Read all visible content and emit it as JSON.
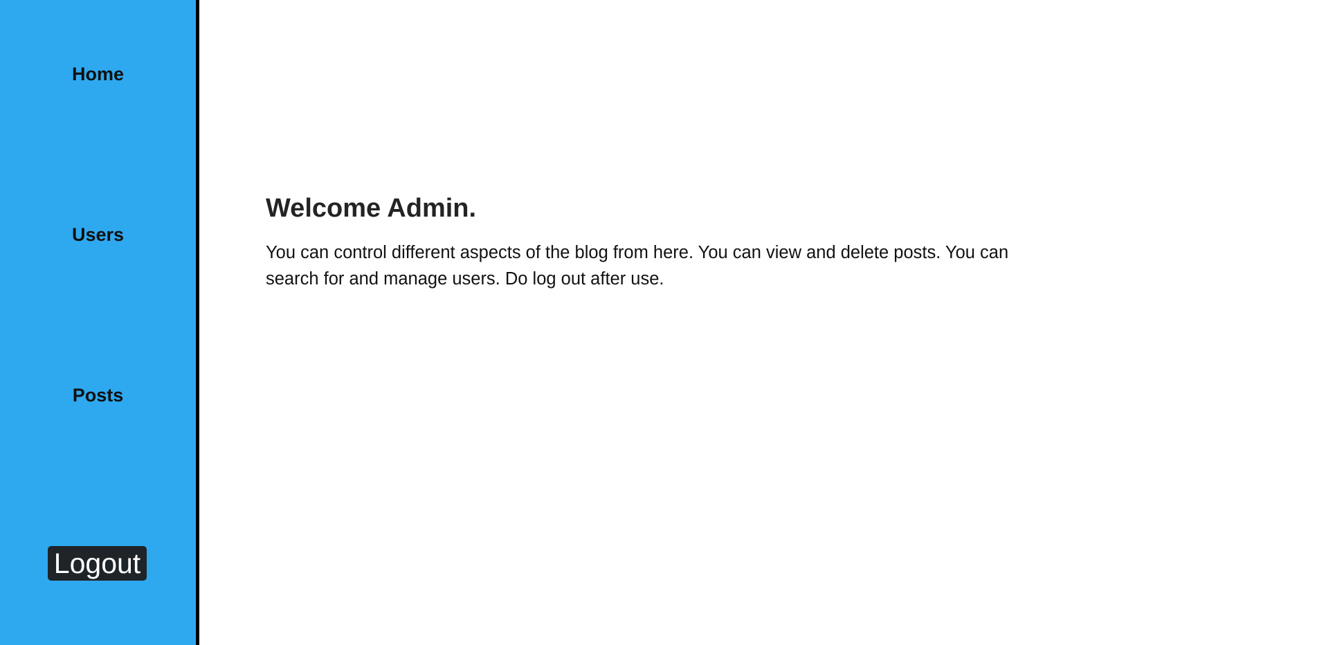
{
  "sidebar": {
    "background_color": "#2ea9f0",
    "items": [
      {
        "label": "Home"
      },
      {
        "label": "Users"
      },
      {
        "label": "Posts"
      }
    ],
    "logout_label": "Logout"
  },
  "main": {
    "title": "Welcome Admin.",
    "description": "You can control different aspects of the blog from here. You can view and delete posts. You can search for and manage users. Do log out after use."
  }
}
